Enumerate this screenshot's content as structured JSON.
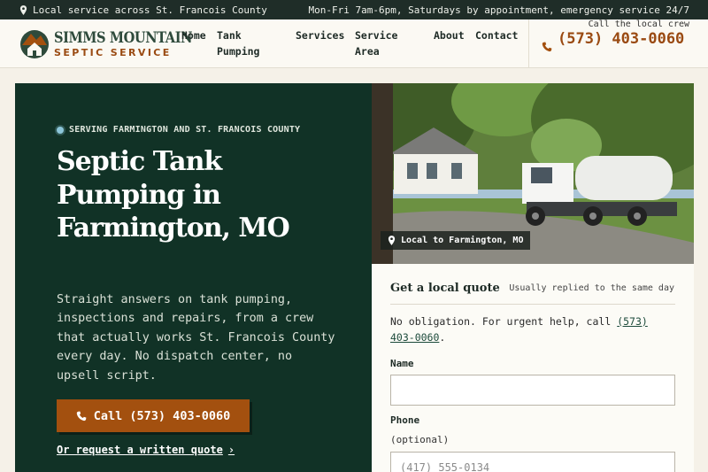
{
  "topbar": {
    "location": "Local service across St. Francois County",
    "hours": "Mon-Fri 7am-6pm, Saturdays by appointment, emergency service 24/7"
  },
  "brand": {
    "name_line1": "SIMMS MOUNTAIN",
    "name_line2": "SEPTIC SERVICE"
  },
  "nav": {
    "home": "Home",
    "pumping": "Tank Pumping",
    "services": "Services",
    "area": "Service Area",
    "about": "About",
    "contact": "Contact"
  },
  "header_call": {
    "caption": "Call the local crew",
    "number": "(573) 403-0060"
  },
  "hero": {
    "eyebrow": "SERVING FARMINGTON AND ST. FRANCOIS COUNTY",
    "title": "Septic Tank Pumping in Farmington, MO",
    "body": "Straight answers on tank pumping, inspections and repairs, from a crew that actually works St. Francois County every day. No dispatch center, no upsell script.",
    "cta_label": "Call (573) 403-0060",
    "link_label": "Or request a written quote"
  },
  "photo": {
    "badge": "Local to Farmington, MO"
  },
  "quote": {
    "title": "Get a local quote",
    "reply_time": "Usually replied to the same day",
    "note_prefix": "No obligation. For urgent help, call ",
    "note_phone": "(573) 403-0060",
    "note_suffix": ".",
    "name_label": "Name",
    "name_value": "",
    "phone_label": "Phone",
    "phone_optional": "(optional)",
    "phone_placeholder": "(417) 555-0134"
  },
  "colors": {
    "dark_green": "#113226",
    "rust": "#a3500f",
    "topbar": "#1f2d28",
    "cream": "#f5f1e8"
  }
}
